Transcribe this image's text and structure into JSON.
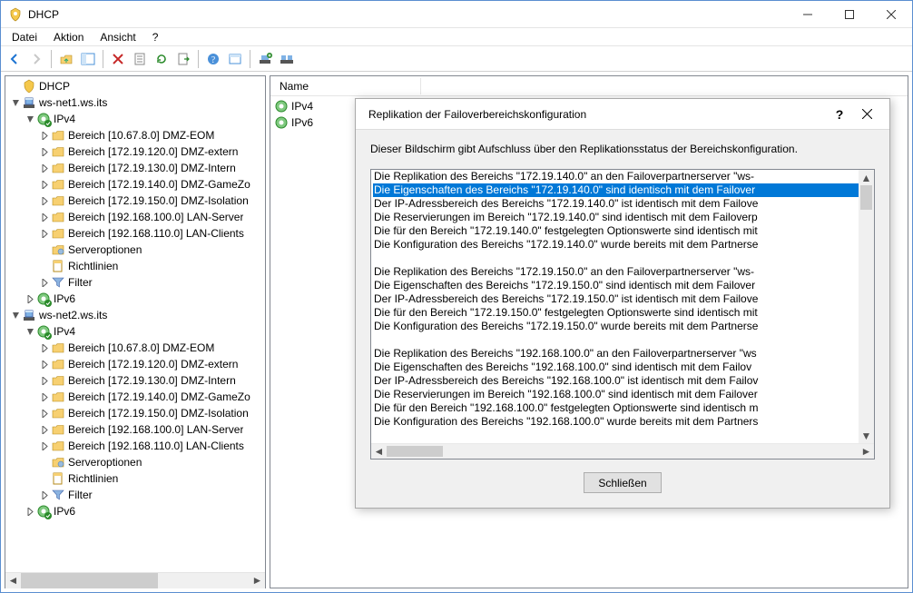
{
  "window": {
    "title": "DHCP"
  },
  "menu": {
    "file": "Datei",
    "action": "Aktion",
    "view": "Ansicht",
    "help": "?"
  },
  "list": {
    "header_name": "Name",
    "items": [
      "IPv4",
      "IPv6"
    ]
  },
  "tree": {
    "root": "DHCP",
    "servers": [
      {
        "name": "ws-net1.ws.its",
        "protocols": [
          {
            "name": "IPv4",
            "scopes": [
              "Bereich [10.67.8.0] DMZ-EOM",
              "Bereich [172.19.120.0] DMZ-extern",
              "Bereich [172.19.130.0] DMZ-Intern",
              "Bereich [172.19.140.0] DMZ-GameZo",
              "Bereich [172.19.150.0] DMZ-Isolation",
              "Bereich [192.168.100.0] LAN-Server",
              "Bereich [192.168.110.0] LAN-Clients"
            ],
            "server_options": "Serveroptionen",
            "policies": "Richtlinien",
            "filter": "Filter"
          },
          {
            "name": "IPv6"
          }
        ]
      },
      {
        "name": "ws-net2.ws.its",
        "protocols": [
          {
            "name": "IPv4",
            "scopes": [
              "Bereich [10.67.8.0] DMZ-EOM",
              "Bereich [172.19.120.0] DMZ-extern",
              "Bereich [172.19.130.0] DMZ-Intern",
              "Bereich [172.19.140.0] DMZ-GameZo",
              "Bereich [172.19.150.0] DMZ-Isolation",
              "Bereich [192.168.100.0] LAN-Server",
              "Bereich [192.168.110.0] LAN-Clients"
            ],
            "server_options": "Serveroptionen",
            "policies": "Richtlinien",
            "filter": "Filter"
          },
          {
            "name": "IPv6"
          }
        ]
      }
    ]
  },
  "dialog": {
    "title": "Replikation der Failoverbereichskonfiguration",
    "description": "Dieser Bildschirm gibt Aufschluss über den Replikationsstatus der Bereichskonfiguration.",
    "close": "Schließen",
    "lines": [
      "Die Replikation des Bereichs \"172.19.140.0\" an den Failoverpartnerserver \"ws-",
      "Die Eigenschaften des Bereichs \"172.19.140.0\" sind identisch mit dem Failover",
      "Der IP-Adressbereich des Bereichs \"172.19.140.0\" ist identisch mit dem Failove",
      "Die Reservierungen im Bereich \"172.19.140.0\" sind identisch mit dem Failoverp",
      "Die für den Bereich \"172.19.140.0\" festgelegten Optionswerte sind identisch mit",
      "Die Konfiguration des Bereichs \"172.19.140.0\" wurde bereits mit dem Partnerse",
      "",
      "Die Replikation des Bereichs \"172.19.150.0\" an den Failoverpartnerserver \"ws-",
      "Die Eigenschaften des Bereichs \"172.19.150.0\" sind identisch mit dem Failover",
      "Der IP-Adressbereich des Bereichs \"172.19.150.0\" ist identisch mit dem Failove",
      "Die für den Bereich \"172.19.150.0\" festgelegten Optionswerte sind identisch mit",
      "Die Konfiguration des Bereichs \"172.19.150.0\" wurde bereits mit dem Partnerse",
      "",
      "Die Replikation des Bereichs \"192.168.100.0\" an den Failoverpartnerserver \"ws",
      "Die Eigenschaften des Bereichs \"192.168.100.0\" sind identisch mit dem Failov",
      "Der IP-Adressbereich des Bereichs \"192.168.100.0\" ist identisch mit dem Failov",
      "Die Reservierungen im Bereich \"192.168.100.0\" sind identisch mit dem Failover",
      "Die für den Bereich \"192.168.100.0\" festgelegten Optionswerte sind identisch m",
      "Die Konfiguration des Bereichs \"192.168.100.0\" wurde bereits mit dem Partners"
    ],
    "selected_index": 1
  }
}
